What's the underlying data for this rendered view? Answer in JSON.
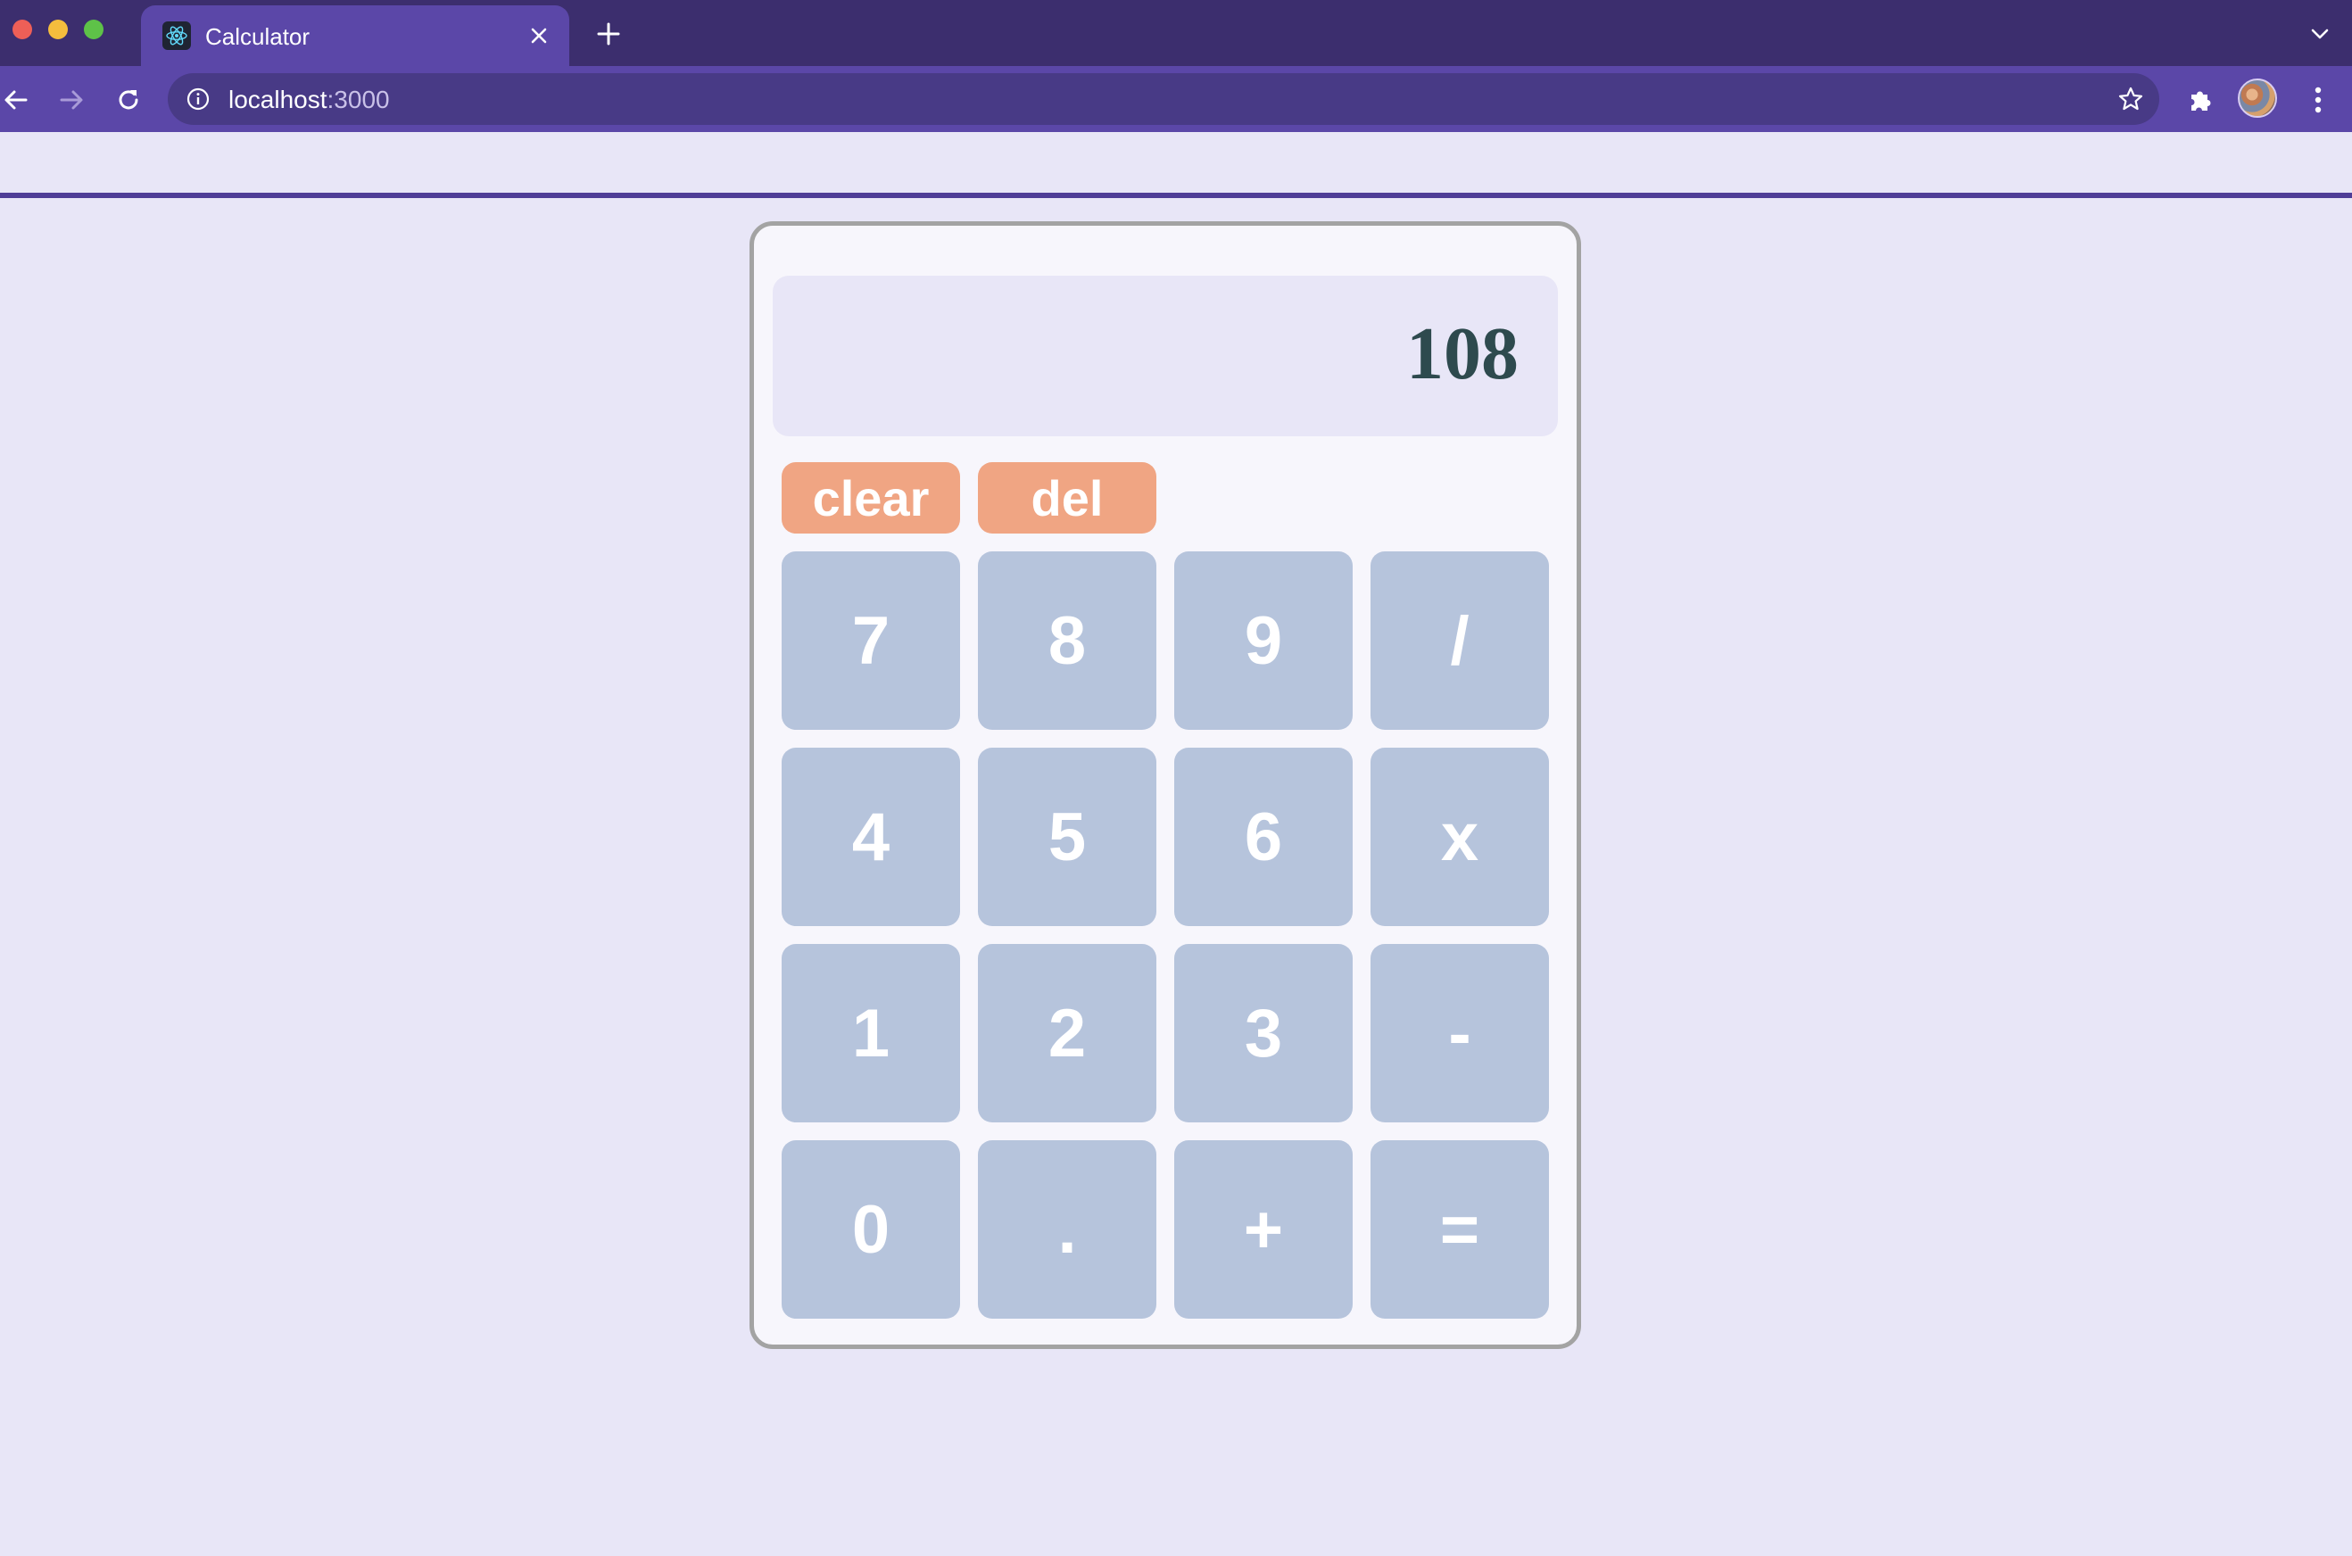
{
  "browser": {
    "tab_title": "Calculator",
    "url_host": "localhost",
    "url_port": ":3000",
    "colors": {
      "tabbar": "#3c2e6e",
      "toolbar": "#5b47a8",
      "omnibox": "#483a86"
    }
  },
  "calculator": {
    "display": "108",
    "actions": {
      "clear": "clear",
      "delete": "del"
    },
    "keys": {
      "seven": "7",
      "eight": "8",
      "nine": "9",
      "divide": "/",
      "four": "4",
      "five": "5",
      "six": "6",
      "multiply": "x",
      "one": "1",
      "two": "2",
      "three": "3",
      "subtract": "-",
      "zero": "0",
      "decimal": ".",
      "add": "+",
      "equals": "="
    },
    "colors": {
      "page_background": "#e8e6f7",
      "display_text": "#2e4a4e",
      "action_button": "#f0a583",
      "key_button": "#b6c4dc",
      "border": "#a3a3a3"
    }
  }
}
